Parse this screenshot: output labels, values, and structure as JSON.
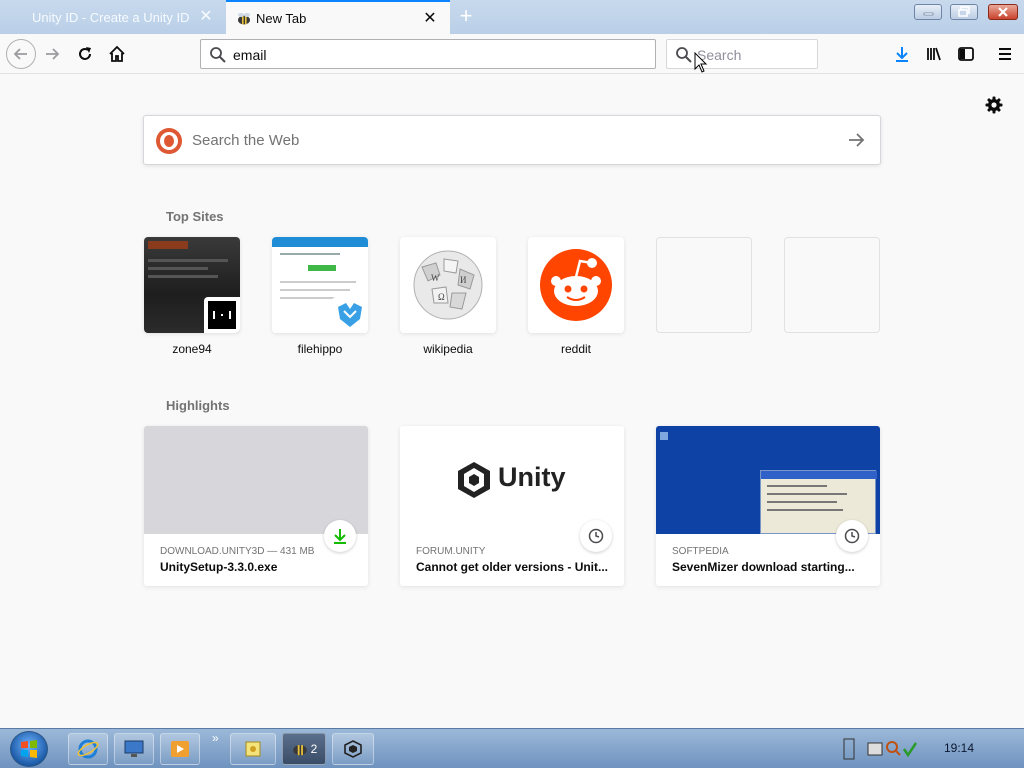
{
  "browser": {
    "tabs": [
      {
        "title": "Unity ID - Create a Unity ID",
        "active": false
      },
      {
        "title": "New Tab",
        "active": true
      }
    ],
    "tab_close_glyph": "✕",
    "new_tab_glyph": "+",
    "url_value": "email",
    "search_placeholder": "Search"
  },
  "newtab": {
    "web_search_placeholder": "Search the Web",
    "top_sites_title": "Top Sites",
    "top_sites": [
      {
        "label": "zone94"
      },
      {
        "label": "filehippo"
      },
      {
        "label": "wikipedia"
      },
      {
        "label": "reddit"
      },
      {
        "label": ""
      },
      {
        "label": ""
      }
    ],
    "highlights_title": "Highlights",
    "highlights": [
      {
        "context": "DOWNLOAD.UNITY3D — 431 MB",
        "title": "UnitySetup-3.3.0.exe",
        "badge": "download-icon"
      },
      {
        "context": "FORUM.UNITY",
        "title": "Cannot get older versions - Unit...",
        "badge": "clock-icon",
        "logo_text": "Unity"
      },
      {
        "context": "SOFTPEDIA",
        "title": "SevenMizer download starting...",
        "badge": "clock-icon"
      }
    ]
  },
  "taskbar": {
    "clock": "19:14",
    "group_count": "2",
    "overflow_glyph": "»"
  },
  "colors": {
    "accent": "#0a84ff",
    "download_green": "#12bc00",
    "reddit": "#ff4500",
    "duckduckgo": "#de5833"
  }
}
